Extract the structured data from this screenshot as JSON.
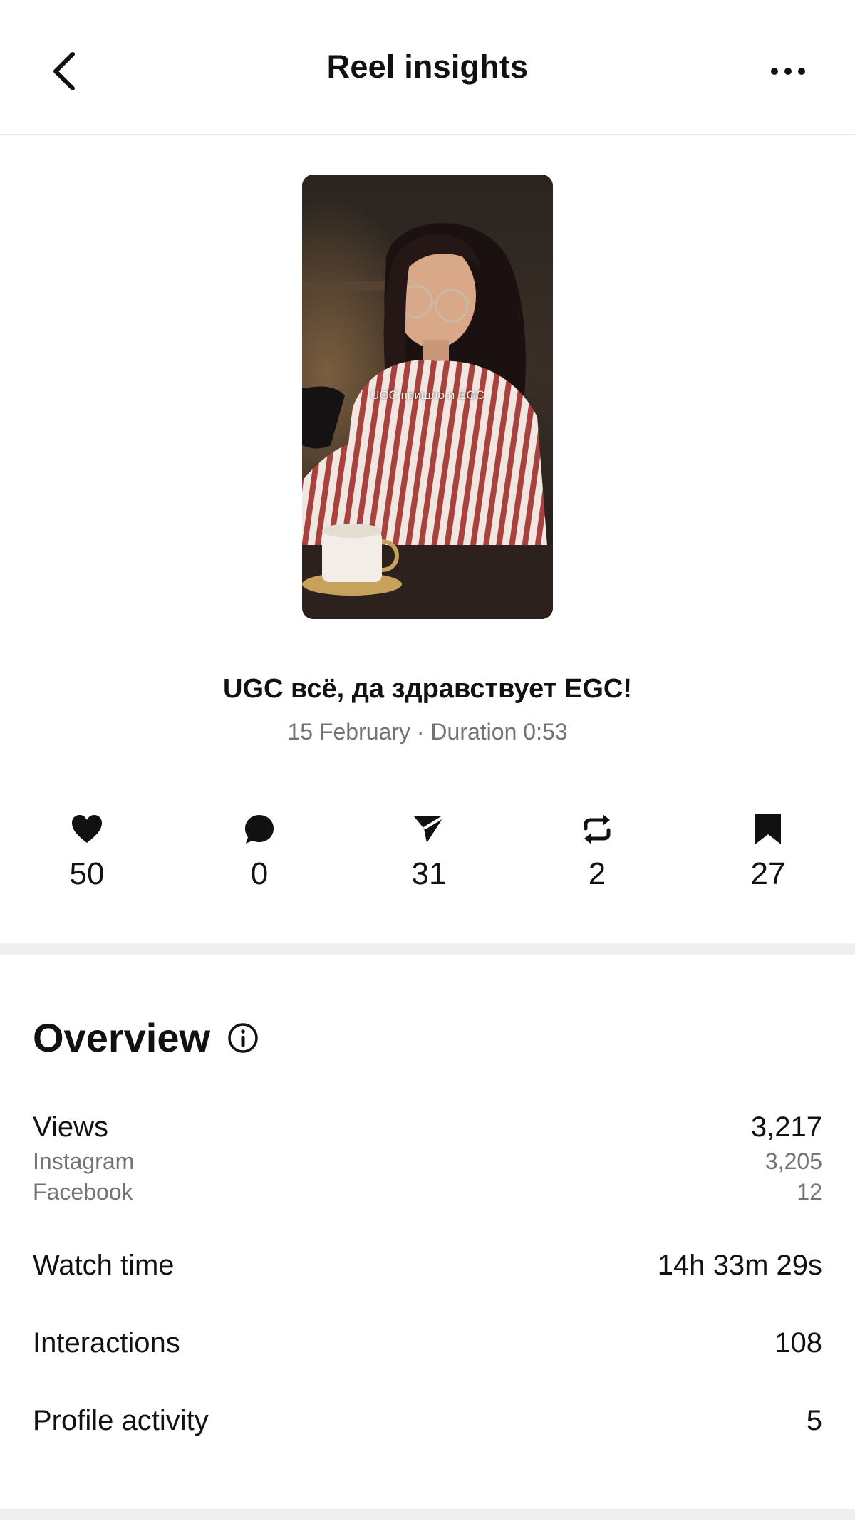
{
  "header": {
    "title": "Reel insights"
  },
  "reel": {
    "thumbnail_caption": "UGC пришло и EGC",
    "title": "UGC всё, да здравствует EGC!",
    "meta": "15 February · Duration 0:53"
  },
  "stats": {
    "likes": "50",
    "comments": "0",
    "shares": "31",
    "reposts": "2",
    "saves": "27"
  },
  "overview": {
    "heading": "Overview",
    "views": {
      "label": "Views",
      "value": "3,217"
    },
    "instagram": {
      "label": "Instagram",
      "value": "3,205"
    },
    "facebook": {
      "label": "Facebook",
      "value": "12"
    },
    "watch_time": {
      "label": "Watch time",
      "value": "14h 33m 29s"
    },
    "interactions": {
      "label": "Interactions",
      "value": "108"
    },
    "profile_activity": {
      "label": "Profile activity",
      "value": "5"
    }
  },
  "icons": {
    "back": "chevron-left-icon",
    "more": "more-horizontal-icon",
    "like": "heart-icon",
    "comment": "comment-bubble-icon",
    "share": "paper-plane-icon",
    "repost": "repost-icon",
    "save": "bookmark-icon",
    "info": "info-icon"
  },
  "colors": {
    "text": "#111111",
    "secondary_text": "#737373",
    "divider": "#efefef"
  }
}
